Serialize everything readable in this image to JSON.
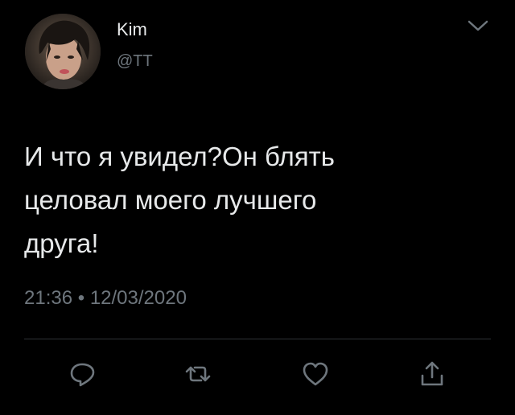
{
  "tweet": {
    "author": {
      "display_name": "Kim",
      "handle": "@TT",
      "avatar_icon": "avatar-photo"
    },
    "text": "И что я увидел?Он блять\nцеловал моего лучшего\nдруга!",
    "time": "21:36",
    "separator": "•",
    "date": "12/03/2020"
  },
  "actions": [
    {
      "name": "reply",
      "icon": "reply-icon"
    },
    {
      "name": "retweet",
      "icon": "retweet-icon"
    },
    {
      "name": "like",
      "icon": "heart-icon"
    },
    {
      "name": "share",
      "icon": "share-icon"
    }
  ],
  "colors": {
    "background": "#000000",
    "primary_text": "#e7e9ea",
    "secondary_text": "#6e767d",
    "icon": "#6e767d",
    "divider": "#2f3336"
  }
}
